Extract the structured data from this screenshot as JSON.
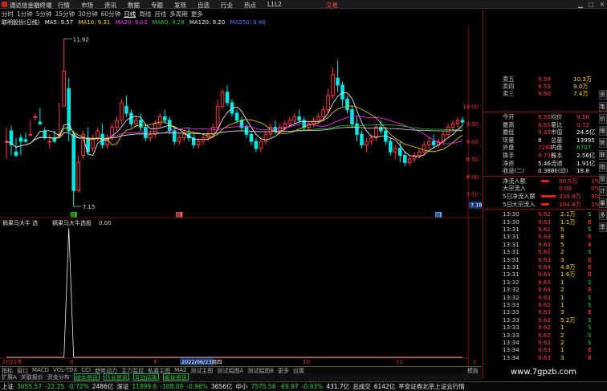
{
  "titlebar": {
    "app": "通达信金融终端",
    "menus": [
      "行情",
      "市场",
      "资讯",
      "数据",
      "专题",
      "发现",
      "自选",
      "行业",
      "热点",
      "L1L2"
    ],
    "right_label": "交易"
  },
  "periods": [
    "分时",
    "1分钟",
    "5分钟",
    "15分钟",
    "30分钟",
    "60分钟",
    "日线",
    "周线",
    "月线",
    "多周期",
    "更多"
  ],
  "active_period": "日线",
  "ma_line": {
    "stock": "联明股份(日线)",
    "ma5": "MA5: 9.57",
    "ma10": "MA10: 9.31",
    "ma20": "MA20: 9.03",
    "ma60": "MA60: 9.26",
    "ma120": "MA120: 9.20",
    "ma250": "MA250: 9.48"
  },
  "colors": {
    "up": "#ff3b3b",
    "down": "#00e5e5",
    "ma5": "#ffffff",
    "ma10": "#ffd900",
    "ma20": "#ff33ff",
    "ma60": "#33cc33",
    "ma120": "#dddddd",
    "ma250": "#5577ff"
  },
  "price_axis": [
    "10.00",
    "9.50",
    "9.00",
    "8.50",
    "8.00",
    "7.50"
  ],
  "price_labels": {
    "high": "11.92",
    "low": "7.15",
    "current_box": "7.18"
  },
  "chart_data": [
    {
      "type": "candlestick",
      "title": "联明股份(日线)",
      "y_range": [
        6.9,
        12.2
      ],
      "high_marker": 11.92,
      "low_marker": 7.15,
      "candles": [
        [
          9.0,
          9.4,
          9.0,
          8.5
        ],
        [
          9.3,
          9.45,
          8.9,
          8.6
        ],
        [
          8.7,
          9.1,
          8.6,
          8.55
        ],
        [
          9.1,
          9.2,
          9.0,
          8.6
        ],
        [
          9.05,
          9.25,
          9.0,
          8.95
        ],
        [
          9.2,
          9.6,
          9.2,
          9.15
        ],
        [
          9.7,
          9.8,
          9.7,
          9.6
        ],
        [
          9.55,
          9.95,
          9.5,
          9.45
        ],
        [
          9.3,
          9.4,
          9.1,
          9.05
        ],
        [
          9.0,
          9.2,
          9.0,
          8.8
        ],
        [
          9.1,
          9.3,
          9.0,
          8.95
        ],
        [
          9.2,
          10.1,
          9.2,
          9.1
        ],
        [
          10.0,
          11.92,
          11.0,
          10.0
        ],
        [
          10.5,
          10.8,
          9.3,
          9.0
        ],
        [
          9.2,
          9.3,
          7.6,
          7.15
        ],
        [
          7.6,
          8.6,
          8.4,
          7.55
        ],
        [
          8.6,
          9.3,
          9.2,
          8.5
        ],
        [
          9.1,
          9.4,
          8.7,
          8.6
        ],
        [
          8.8,
          9.2,
          9.1,
          8.7
        ],
        [
          9.1,
          9.4,
          9.3,
          9.0
        ],
        [
          9.2,
          9.5,
          8.9,
          8.8
        ],
        [
          8.9,
          9.2,
          9.1,
          8.8
        ],
        [
          9.1,
          9.5,
          9.4,
          9.0
        ],
        [
          9.4,
          9.7,
          9.6,
          9.3
        ],
        [
          9.6,
          10.2,
          10.1,
          9.5
        ],
        [
          10.0,
          10.3,
          9.8,
          9.7
        ],
        [
          9.8,
          9.9,
          9.5,
          9.4
        ],
        [
          9.5,
          9.7,
          9.6,
          9.4
        ],
        [
          9.6,
          9.8,
          9.4,
          9.3
        ],
        [
          9.4,
          9.5,
          9.1,
          9.0
        ],
        [
          9.1,
          9.3,
          9.2,
          9.0
        ],
        [
          9.2,
          9.6,
          9.5,
          9.1
        ],
        [
          9.5,
          9.8,
          9.7,
          9.4
        ],
        [
          9.7,
          9.9,
          9.6,
          9.5
        ],
        [
          9.6,
          9.7,
          9.3,
          9.2
        ],
        [
          9.3,
          9.4,
          9.0,
          8.9
        ],
        [
          9.0,
          9.2,
          9.1,
          8.9
        ],
        [
          9.1,
          9.3,
          9.2,
          9.0
        ],
        [
          9.2,
          9.4,
          9.1,
          9.0
        ],
        [
          9.1,
          9.2,
          8.9,
          8.8
        ],
        [
          8.9,
          9.1,
          9.0,
          8.8
        ],
        [
          9.0,
          9.2,
          9.1,
          8.9
        ],
        [
          9.1,
          9.3,
          9.2,
          9.0
        ],
        [
          9.2,
          9.5,
          9.4,
          9.1
        ],
        [
          9.4,
          10.2,
          10.0,
          9.3
        ],
        [
          10.0,
          10.5,
          10.4,
          9.9
        ],
        [
          10.4,
          10.6,
          10.1,
          10.0
        ],
        [
          10.1,
          10.2,
          9.8,
          9.7
        ],
        [
          9.8,
          9.9,
          9.6,
          9.5
        ],
        [
          9.6,
          9.7,
          9.4,
          9.3
        ],
        [
          9.4,
          9.5,
          9.2,
          9.1
        ],
        [
          9.2,
          9.3,
          9.0,
          8.9
        ],
        [
          9.0,
          9.1,
          8.8,
          8.7
        ],
        [
          8.8,
          9.1,
          9.0,
          8.7
        ],
        [
          9.0,
          9.3,
          9.2,
          8.9
        ],
        [
          9.2,
          9.5,
          9.4,
          9.1
        ],
        [
          9.4,
          9.6,
          9.3,
          9.2
        ],
        [
          9.3,
          9.5,
          9.4,
          9.2
        ],
        [
          9.4,
          9.6,
          9.5,
          9.3
        ],
        [
          9.5,
          9.7,
          9.6,
          9.4
        ],
        [
          9.6,
          9.8,
          9.7,
          9.5
        ],
        [
          9.7,
          9.9,
          9.6,
          9.5
        ],
        [
          9.6,
          9.7,
          9.4,
          9.3
        ],
        [
          9.4,
          9.6,
          9.5,
          9.3
        ],
        [
          9.5,
          9.7,
          9.6,
          9.4
        ],
        [
          9.6,
          9.8,
          9.7,
          9.5
        ],
        [
          9.7,
          10.0,
          9.9,
          9.6
        ],
        [
          9.9,
          10.5,
          10.3,
          9.8
        ],
        [
          10.3,
          11.1,
          10.9,
          10.2
        ],
        [
          10.8,
          11.3,
          10.6,
          10.4
        ],
        [
          10.6,
          10.7,
          10.2,
          10.0
        ],
        [
          10.2,
          10.3,
          9.9,
          9.8
        ],
        [
          9.9,
          10.0,
          9.5,
          9.4
        ],
        [
          9.5,
          9.7,
          9.2,
          9.0
        ],
        [
          9.2,
          9.3,
          8.9,
          8.8
        ],
        [
          8.9,
          9.1,
          9.0,
          8.7
        ],
        [
          9.0,
          9.2,
          9.1,
          8.9
        ],
        [
          9.1,
          9.5,
          9.4,
          9.0
        ],
        [
          9.4,
          9.6,
          9.3,
          9.2
        ],
        [
          9.3,
          9.4,
          9.0,
          8.9
        ],
        [
          9.0,
          9.1,
          8.7,
          8.6
        ],
        [
          8.7,
          8.9,
          8.8,
          8.5
        ],
        [
          8.8,
          9.0,
          8.6,
          8.4
        ],
        [
          8.6,
          8.7,
          8.4,
          8.3
        ],
        [
          8.4,
          8.6,
          8.5,
          8.3
        ],
        [
          8.5,
          8.7,
          8.6,
          8.4
        ],
        [
          8.6,
          8.8,
          8.7,
          8.5
        ],
        [
          8.7,
          9.0,
          8.9,
          8.6
        ],
        [
          8.9,
          9.1,
          9.0,
          8.8
        ],
        [
          9.0,
          9.2,
          8.9,
          8.8
        ],
        [
          8.9,
          9.1,
          9.0,
          8.8
        ],
        [
          9.0,
          9.3,
          9.2,
          8.9
        ],
        [
          9.2,
          9.5,
          9.4,
          9.1
        ],
        [
          9.4,
          9.6,
          9.5,
          9.3
        ],
        [
          9.5,
          9.7,
          9.6,
          9.4
        ],
        [
          9.6,
          9.7,
          9.55,
          9.45
        ]
      ]
    },
    {
      "type": "line",
      "title": "摘果马大牛 选",
      "series": [
        {
          "name": "摘果马大牛选股",
          "values": [
            0,
            0,
            0,
            0,
            0,
            0,
            0,
            0,
            0,
            0,
            0,
            0,
            0,
            1,
            0,
            0,
            0,
            0,
            0,
            0,
            0,
            0,
            0,
            0,
            0,
            0,
            0,
            0,
            0,
            0,
            0,
            0,
            0,
            0,
            0,
            0,
            0,
            0,
            0,
            0,
            0,
            0,
            0,
            0,
            0,
            0,
            0,
            0,
            0,
            0,
            0,
            0,
            0,
            0,
            0,
            0,
            0,
            0,
            0,
            0,
            0,
            0,
            0,
            0,
            0,
            0,
            0,
            0,
            0,
            0,
            0,
            0,
            0,
            0,
            0,
            0,
            0,
            0,
            0,
            0,
            0,
            0,
            0,
            0,
            0,
            0,
            0,
            0,
            0,
            0,
            0,
            0,
            0,
            0,
            0,
            0
          ]
        }
      ],
      "y_range": [
        0,
        1
      ]
    }
  ],
  "sub_indicator": {
    "name": "摘果马大牛 选",
    "label": "摘果马大牛选股",
    "value": "0.00"
  },
  "date_axis": {
    "left": "2022年",
    "center": "2022/06/23周四",
    "right": "2",
    "t1": "8",
    "t2": "6",
    "t3": "10",
    "t4": "11"
  },
  "markers": {
    "low_tag": "跌",
    "tag_mid": "跌",
    "tag_right": "周"
  },
  "quote_panel": {
    "asks": [
      {
        "label": "卖五",
        "price": "9.58",
        "vol": "10.3万"
      },
      {
        "label": "卖四",
        "price": "9.59",
        "vol": "9.0万"
      },
      {
        "label": "卖三",
        "price": "9.60",
        "vol": "7.4万"
      }
    ],
    "stats": [
      {
        "l1": "今开",
        "v1": "9.59",
        "l2": "均价",
        "v2": "9.56"
      },
      {
        "l1": "最高",
        "v1": "9.65",
        "l2": "量比",
        "v2": "0.72"
      },
      {
        "l1": "最低",
        "v1": "9.45",
        "l2": "市值",
        "v2": "24.5亿"
      },
      {
        "l1": "现量",
        "v1": "8",
        "l2": "总量",
        "v2": "13995"
      },
      {
        "l1": "外盘",
        "v1": "7288",
        "l2": "内盘",
        "v2": "6707"
      },
      {
        "l1": "换手",
        "v1": "0.73%",
        "l2": "股本",
        "v2": "2.56亿"
      },
      {
        "l1": "净资",
        "v1": "5.46",
        "l2": "流通",
        "v2": "1.91亿"
      },
      {
        "l1": "收益(二)",
        "v1": "0.380",
        "l2": "PE(动)",
        "v2": "18.8"
      }
    ],
    "flows": [
      {
        "label": "净流入额",
        "value": "50.5万",
        "pct": "1%"
      },
      {
        "label": "大宗流入",
        "value": "0.00",
        "pct": "0%"
      },
      {
        "label": "5日净流入额",
        "value": "330.0万",
        "pct": "3%"
      },
      {
        "label": "5日大宗流入",
        "value": "104.8万",
        "pct": "1%"
      }
    ],
    "ticks": [
      [
        "13:30",
        "9.62",
        "2.1万",
        "S"
      ],
      [
        "13:30",
        "9.63",
        "1.1万",
        "B"
      ],
      [
        "13:31",
        "9.61",
        "5",
        "S"
      ],
      [
        "13:31",
        "9.63",
        "8",
        "B"
      ],
      [
        "13:31",
        "9.63",
        "5",
        "B"
      ],
      [
        "13:31",
        "9.62",
        "2",
        "S"
      ],
      [
        "13:31",
        "9.63",
        "3",
        "B"
      ],
      [
        "13:31",
        "9.64",
        "4.8万",
        "B"
      ],
      [
        "13:31",
        "9.64",
        "1.6万",
        "B"
      ],
      [
        "13:32",
        "9.63",
        "1",
        "S"
      ],
      [
        "13:32",
        "9.64",
        "2",
        "B"
      ],
      [
        "13:32",
        "9.63",
        "1",
        "S"
      ],
      [
        "13:33",
        "9.62",
        "1",
        "S"
      ],
      [
        "13:33",
        "9.63",
        "3",
        "B"
      ],
      [
        "13:33",
        "9.63",
        "5.2万",
        "S"
      ],
      [
        "13:33",
        "9.62",
        "1",
        "S"
      ],
      [
        "13:33",
        "9.62",
        "2",
        "S"
      ],
      [
        "13:34",
        "9.62",
        "2",
        "S"
      ],
      [
        "13:34",
        "9.63",
        "1",
        "B"
      ],
      [
        "13:34",
        "9.63",
        "3",
        "B"
      ]
    ]
  },
  "side_tabs": [
    "资",
    "笔",
    "价",
    "细",
    "势",
    "联",
    "指",
    "管",
    "计",
    "量",
    "多",
    "季"
  ],
  "tabs_row1": [
    "指标",
    "窗口",
    "MACD",
    "VOL-TDX",
    "CCI",
    "趋势动力",
    "主力监控",
    "私募主图",
    "MA2",
    "测试主图",
    "测试幅图A",
    "测试幅图B",
    "更多",
    "设置"
  ],
  "tabs_row2": [
    "扩展A",
    "关联报价",
    "资金分布",
    "综合资讯",
    "行业资讯",
    "互动问答",
    "板块资讯"
  ],
  "tabs_right": "模板",
  "statusbar": {
    "items": [
      {
        "name": "上证",
        "value": "3055.57",
        "chg": "-22.25",
        "pct": "-0.72%",
        "vol": "2486亿"
      },
      {
        "name": "深证",
        "value": "11899.6",
        "chg": "-108.09",
        "pct": "-0.96%",
        "vol": "3656亿"
      },
      {
        "name": "中小",
        "value": "7575.56",
        "chg": "-69.97",
        "pct": "-0.93%",
        "vol": "431.7亿"
      }
    ],
    "total_label": "总成交",
    "total": "6142亿",
    "broker": "平安证券北京上证云行情"
  },
  "watermark": "www.7gpzb.com"
}
